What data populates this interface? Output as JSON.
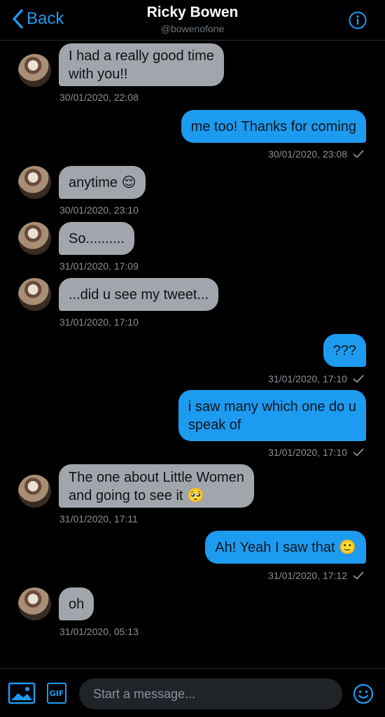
{
  "header": {
    "back_label": "Back",
    "name": "Ricky Bowen",
    "handle": "@bowenofone"
  },
  "messages": [
    {
      "line1": "I had a really good time",
      "line2": "with you!!",
      "time": "30/01/2020, 22:08"
    },
    {
      "text": "me too! Thanks for coming",
      "time": "30/01/2020, 23:08"
    },
    {
      "text": "anytime 😌",
      "time": "30/01/2020, 23:10"
    },
    {
      "text": "So..........",
      "time": "31/01/2020, 17:09"
    },
    {
      "text": "...did u see my tweet...",
      "time": "31/01/2020, 17:10"
    },
    {
      "text": "???",
      "time": "31/01/2020, 17:10"
    },
    {
      "line1": "i saw many which one do u",
      "line2": "speak of",
      "time": "31/01/2020, 17:10"
    },
    {
      "line1": "The one about Little Women",
      "line2": "and going to see it 🥺",
      "time": "31/01/2020, 17:11"
    },
    {
      "text": "Ah! Yeah I saw that 🙂",
      "time": "31/01/2020, 17:12"
    },
    {
      "text": "oh",
      "time": "31/01/2020, 05:13"
    }
  ],
  "composer": {
    "placeholder": "Start a message...",
    "gif_label": "GIF"
  },
  "colors": {
    "accent": "#1d9bf0",
    "incoming_bubble": "#a1a6ad",
    "background": "#000000"
  }
}
